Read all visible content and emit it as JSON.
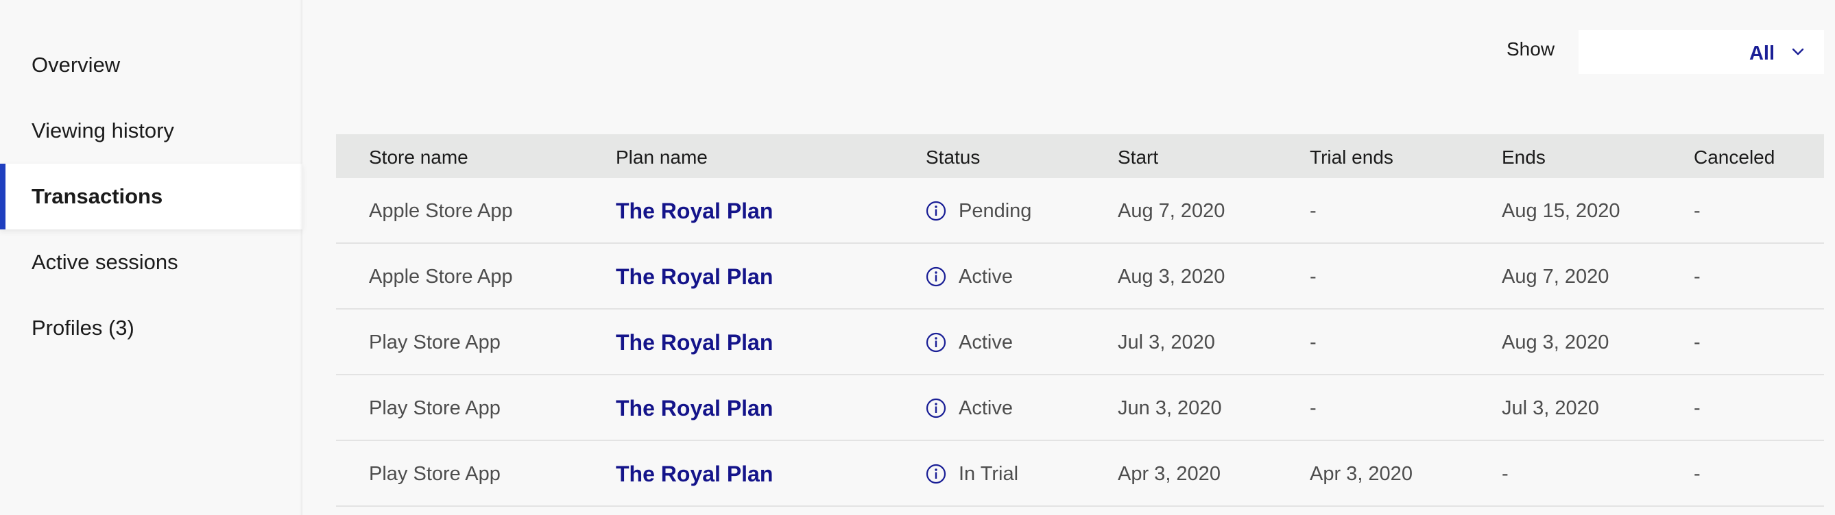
{
  "sidebar": {
    "items": [
      {
        "label": "Overview",
        "active": false
      },
      {
        "label": "Viewing history",
        "active": false
      },
      {
        "label": "Transactions",
        "active": true
      },
      {
        "label": "Active sessions",
        "active": false
      },
      {
        "label": "Profiles (3)",
        "active": false
      }
    ]
  },
  "filter": {
    "label": "Show",
    "selected": "All"
  },
  "table": {
    "headers": [
      "Store name",
      "Plan name",
      "Status",
      "Start",
      "Trial ends",
      "Ends",
      "Canceled"
    ],
    "rows": [
      {
        "store": "Apple Store App",
        "plan": "The Royal Plan",
        "status": "Pending",
        "start": "Aug 7, 2020",
        "trial_ends": "-",
        "ends": "Aug 15, 2020",
        "canceled": "-"
      },
      {
        "store": "Apple Store App",
        "plan": "The Royal Plan",
        "status": "Active",
        "start": "Aug 3, 2020",
        "trial_ends": "-",
        "ends": "Aug 7, 2020",
        "canceled": "-"
      },
      {
        "store": "Play Store App",
        "plan": "The Royal Plan",
        "status": "Active",
        "start": "Jul 3, 2020",
        "trial_ends": "-",
        "ends": "Aug 3, 2020",
        "canceled": "-"
      },
      {
        "store": "Play Store App",
        "plan": "The Royal Plan",
        "status": "Active",
        "start": "Jun 3, 2020",
        "trial_ends": "-",
        "ends": "Jul 3, 2020",
        "canceled": "-"
      },
      {
        "store": "Play Store App",
        "plan": "The Royal Plan",
        "status": "In Trial",
        "start": "Apr 3, 2020",
        "trial_ends": "Apr 3, 2020",
        "ends": "-",
        "canceled": "-"
      }
    ]
  },
  "icons": {
    "status": "info-circle-icon",
    "dropdown": "chevron-down-icon"
  },
  "colors": {
    "accent": "#1f3fbf",
    "link": "#14148a"
  }
}
